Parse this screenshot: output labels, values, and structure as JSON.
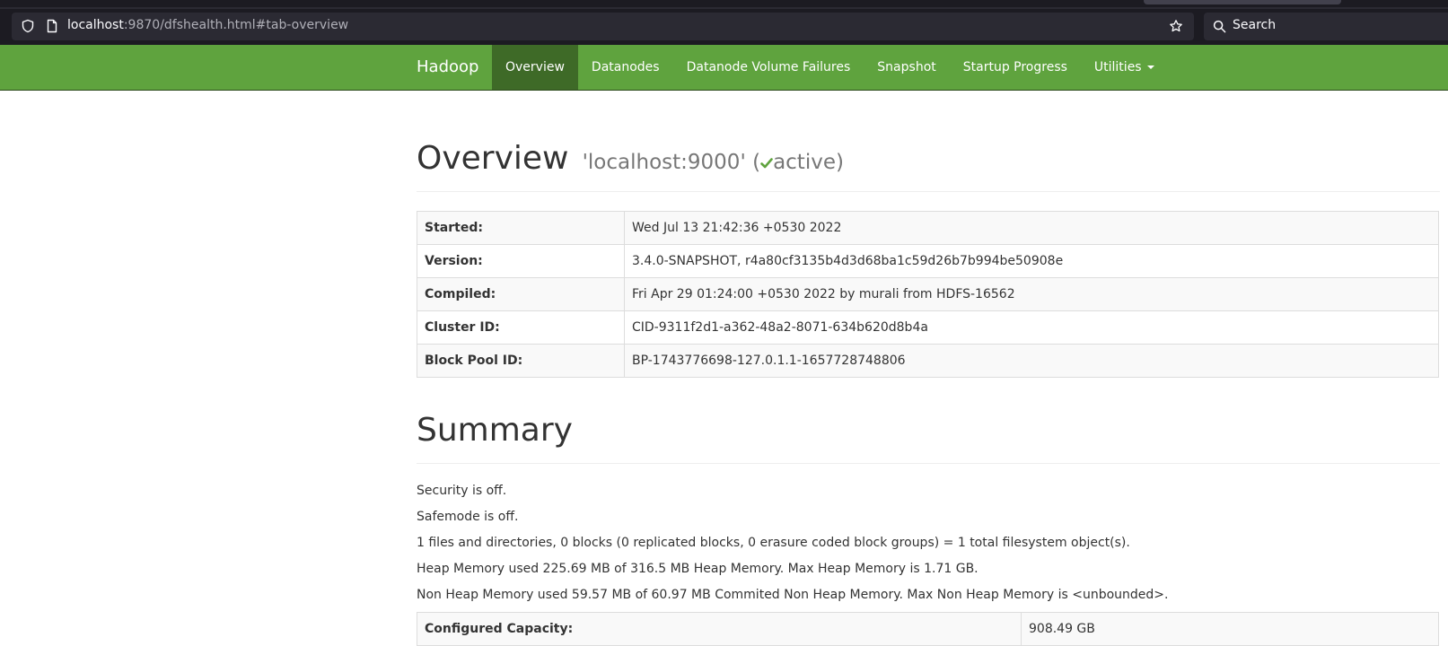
{
  "browser": {
    "url_host": "localhost",
    "url_rest": ":9870/dfshealth.html#tab-overview",
    "search_placeholder": "Search"
  },
  "navbar": {
    "brand": "Hadoop",
    "items": [
      {
        "label": "Overview",
        "active": true
      },
      {
        "label": "Datanodes"
      },
      {
        "label": "Datanode Volume Failures"
      },
      {
        "label": "Snapshot"
      },
      {
        "label": "Startup Progress"
      },
      {
        "label": "Utilities"
      }
    ]
  },
  "overview": {
    "title": "Overview",
    "subtitle_pre": "'localhost:9000' (",
    "subtitle_status": "active",
    "subtitle_post": ")",
    "rows": [
      {
        "label": "Started:",
        "value": "Wed Jul 13 21:42:36 +0530 2022"
      },
      {
        "label": "Version:",
        "value": "3.4.0-SNAPSHOT, r4a80cf3135b4d3d68ba1c59d26b7b994be50908e"
      },
      {
        "label": "Compiled:",
        "value": "Fri Apr 29 01:24:00 +0530 2022 by murali from HDFS-16562"
      },
      {
        "label": "Cluster ID:",
        "value": "CID-9311f2d1-a362-48a2-8071-634b620d8b4a"
      },
      {
        "label": "Block Pool ID:",
        "value": "BP-1743776698-127.0.1.1-1657728748806"
      }
    ]
  },
  "summary": {
    "title": "Summary",
    "lines": [
      "Security is off.",
      "Safemode is off.",
      "1 files and directories, 0 blocks (0 replicated blocks, 0 erasure coded block groups) = 1 total filesystem object(s).",
      "Heap Memory used 225.69 MB of 316.5 MB Heap Memory. Max Heap Memory is 1.71 GB.",
      "Non Heap Memory used 59.57 MB of 60.97 MB Commited Non Heap Memory. Max Non Heap Memory is <unbounded>."
    ],
    "capacity_rows": [
      {
        "label": "Configured Capacity:",
        "value": "908.49 GB"
      }
    ]
  },
  "colors": {
    "navbar_bg": "#5fa33e",
    "navbar_active": "#3e6a27",
    "status_check": "#5fa33e"
  }
}
